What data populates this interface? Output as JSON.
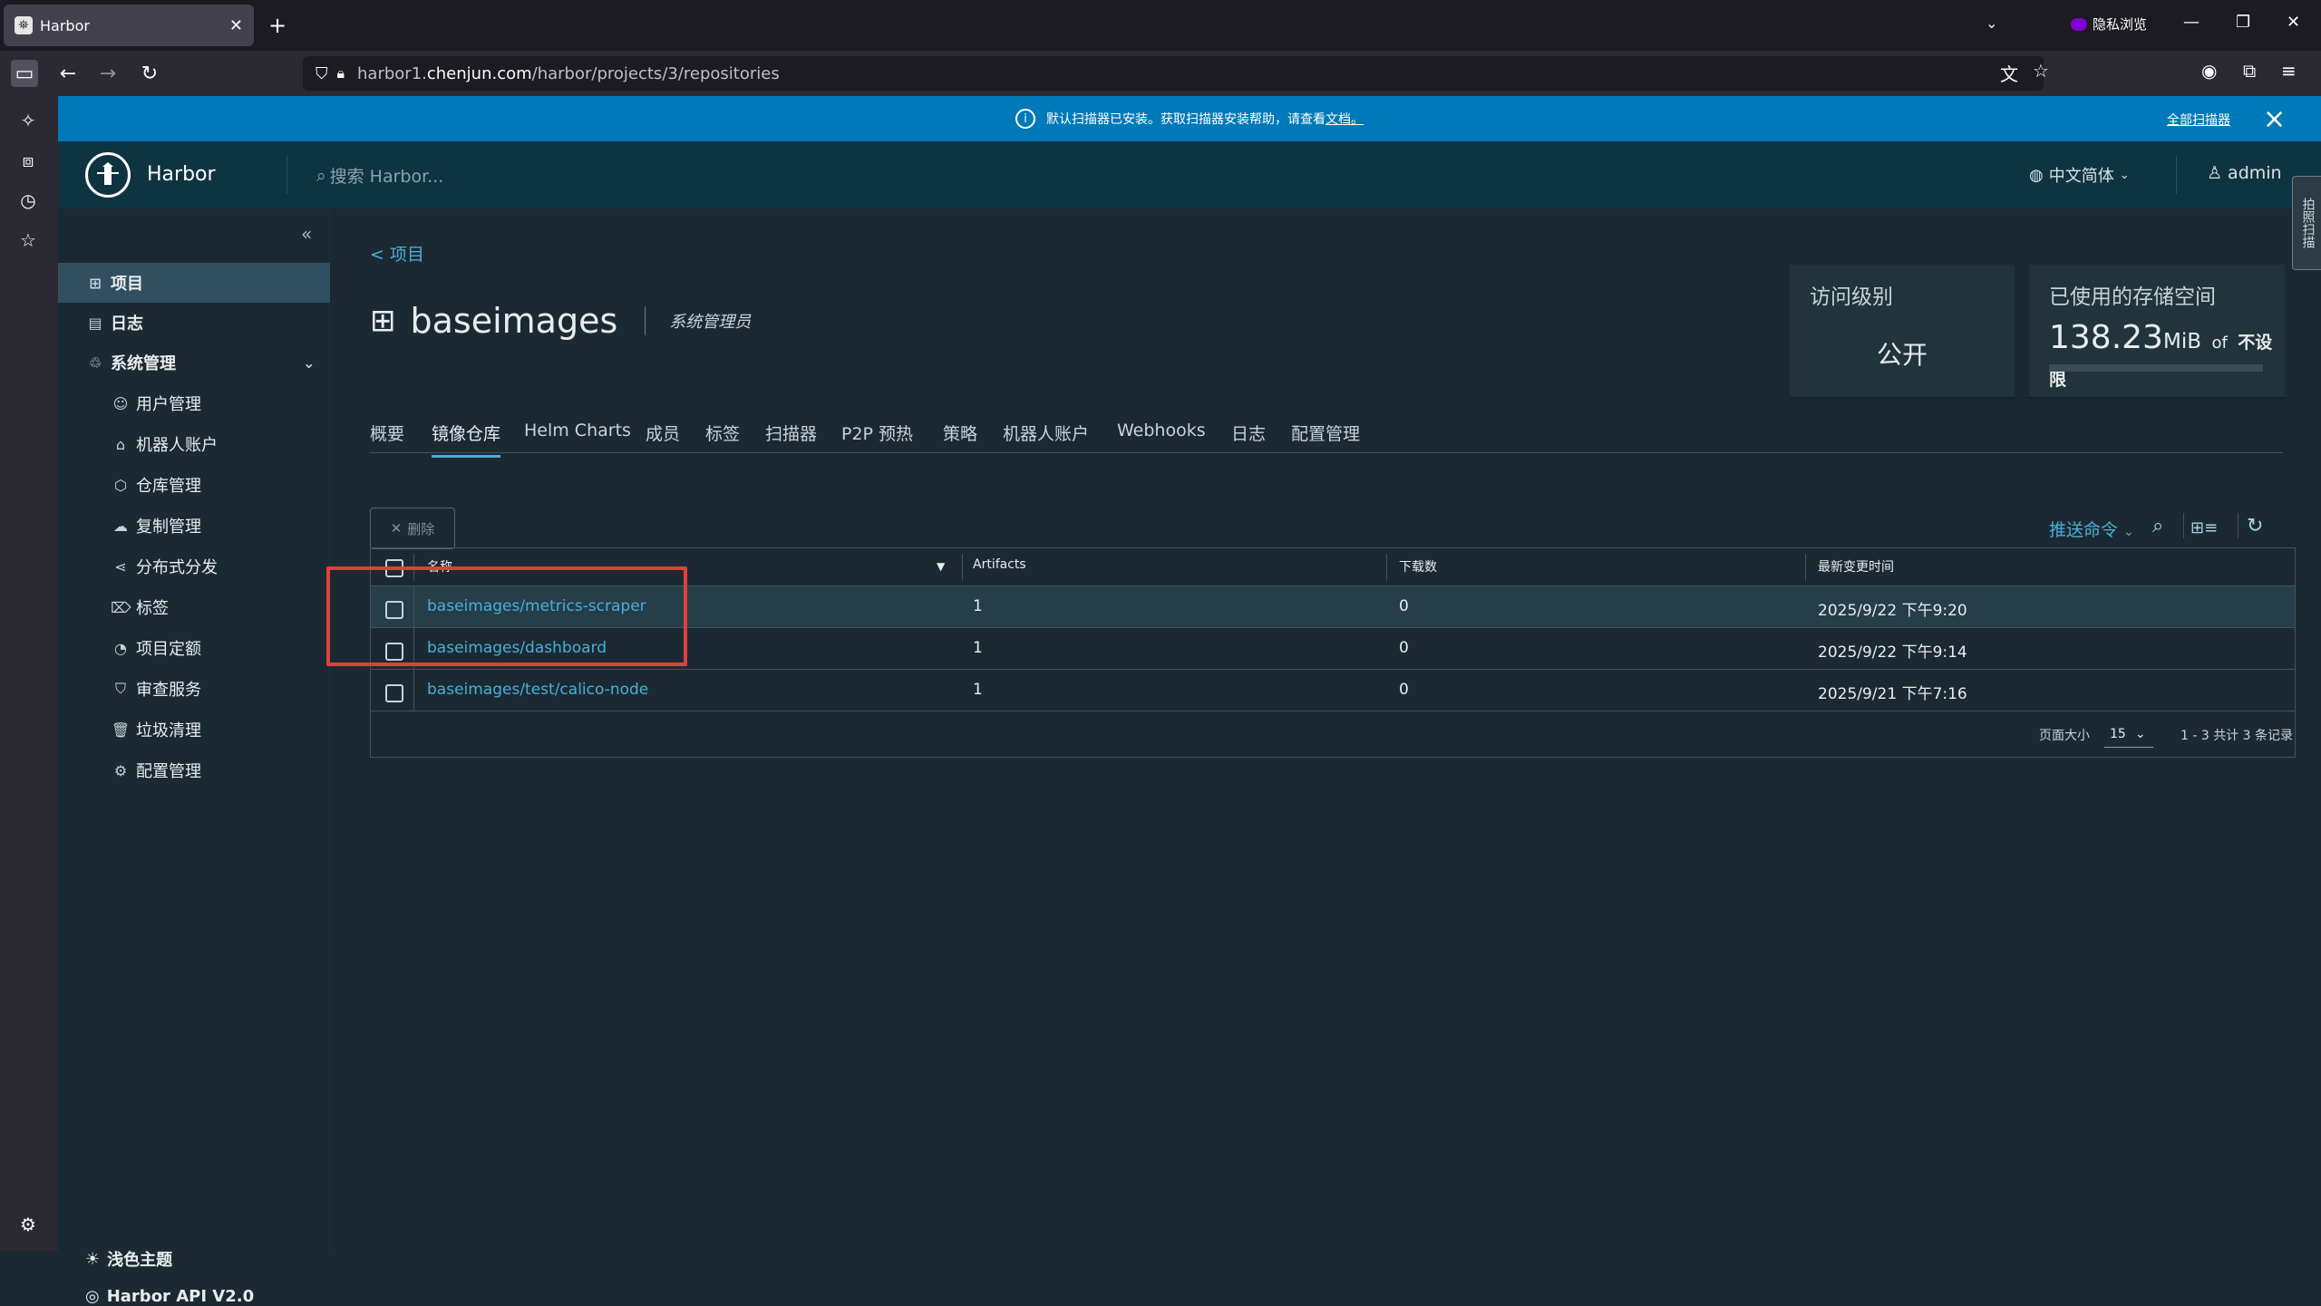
{
  "browser": {
    "tab_title": "Harbor",
    "private_label": "隐私浏览",
    "url_prefix": "harbor1.",
    "url_domain": "chenjun.com",
    "url_path": "/harbor/projects/3/repositories"
  },
  "banner": {
    "message": "默认扫描器已安装。获取扫描器安装帮助，请查看",
    "link": "文档。",
    "action": "全部扫描器"
  },
  "header": {
    "brand": "Harbor",
    "search_placeholder": "搜索 Harbor...",
    "language": "中文简体",
    "user": "admin",
    "feedback": "拍照扫描"
  },
  "sidenav": {
    "items": [
      {
        "label": "项目",
        "icon": "project-icon"
      },
      {
        "label": "日志",
        "icon": "log-icon"
      },
      {
        "label": "系统管理",
        "icon": "admin-icon"
      }
    ],
    "sub_items": [
      {
        "label": "用户管理"
      },
      {
        "label": "机器人账户"
      },
      {
        "label": "仓库管理"
      },
      {
        "label": "复制管理"
      },
      {
        "label": "分布式分发"
      },
      {
        "label": "标签"
      },
      {
        "label": "项目定额"
      },
      {
        "label": "审查服务"
      },
      {
        "label": "垃圾清理"
      },
      {
        "label": "配置管理"
      }
    ],
    "theme": "浅色主题",
    "api": "Harbor API V2.0"
  },
  "project": {
    "back": "< 项目",
    "name": "baseimages",
    "role": "系统管理员",
    "access_title": "访问级别",
    "access_value": "公开",
    "storage_title": "已使用的存储空间",
    "storage_value": "138.23",
    "storage_unit": "MiB",
    "storage_of": "of",
    "storage_limit": "不设限"
  },
  "tabs": [
    "概要",
    "镜像仓库",
    "Helm Charts",
    "成员",
    "标签",
    "扫描器",
    "P2P 预热",
    "策略",
    "机器人账户",
    "Webhooks",
    "日志",
    "配置管理"
  ],
  "toolbar": {
    "delete": "删除",
    "push_command": "推送命令"
  },
  "table": {
    "headers": [
      "名称",
      "Artifacts",
      "下载数",
      "最新变更时间"
    ],
    "rows": [
      {
        "name": "baseimages/metrics-scraper",
        "artifacts": "1",
        "pulls": "0",
        "time": "2025/9/22 下午9:20"
      },
      {
        "name": "baseimages/dashboard",
        "artifacts": "1",
        "pulls": "0",
        "time": "2025/9/22 下午9:14"
      },
      {
        "name": "baseimages/test/calico-node",
        "artifacts": "1",
        "pulls": "0",
        "time": "2025/9/21 下午7:16"
      }
    ],
    "page_size_label": "页面大小",
    "page_size": "15",
    "summary": "1 - 3 共计 3 条记录"
  },
  "colors": {
    "accent": "#4aaed9",
    "banner": "#0079b8",
    "header": "#0f3441",
    "highlight": "#e0403a"
  }
}
